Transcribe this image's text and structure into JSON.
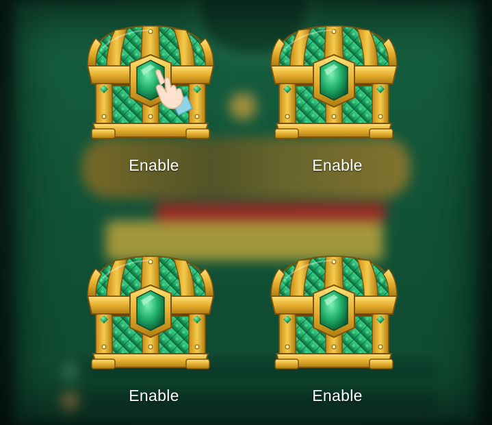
{
  "chests": [
    {
      "label": "Enable",
      "icon": "treasure-chest-icon"
    },
    {
      "label": "Enable",
      "icon": "treasure-chest-icon"
    },
    {
      "label": "Enable",
      "icon": "treasure-chest-icon"
    },
    {
      "label": "Enable",
      "icon": "treasure-chest-icon"
    }
  ],
  "pointer": {
    "icon": "pointing-hand-icon",
    "target_chest": 1
  },
  "colors": {
    "gold": "#e6b030",
    "gold_dark": "#b07d12",
    "emerald": "#1fa866",
    "emerald_dark": "#0d6b3e",
    "label_text": "#ffffff",
    "background": "#144c36"
  }
}
